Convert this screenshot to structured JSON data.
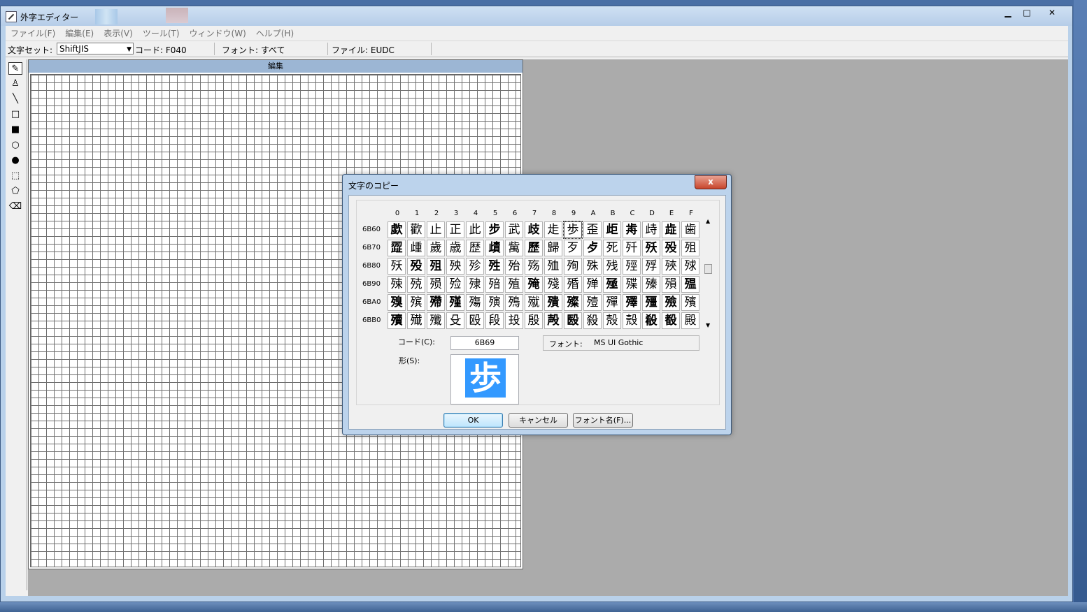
{
  "window": {
    "title": "外字エディター",
    "buttons": {
      "minimize": "▁",
      "maximize": "□",
      "close": "✕"
    }
  },
  "menu": [
    "ファイル(F)",
    "編集(E)",
    "表示(V)",
    "ツール(T)",
    "ウィンドウ(W)",
    "ヘルプ(H)"
  ],
  "infobar": {
    "charset_label": "文字セット:",
    "charset_value": "ShiftJIS",
    "code": "コード: F040",
    "font": "フォント: すべて",
    "file": "ファイル: EUDC"
  },
  "tools": [
    "pencil-icon",
    "brush-icon",
    "line-icon",
    "hollow-rect-icon",
    "filled-rect-icon",
    "hollow-ellipse-icon",
    "filled-ellipse-icon",
    "rect-select-icon",
    "freeform-select-icon",
    "eraser-icon"
  ],
  "editor": {
    "title": "編集"
  },
  "dialog": {
    "title": "文字のコピー",
    "close": "x",
    "columns": [
      "0",
      "1",
      "2",
      "3",
      "4",
      "5",
      "6",
      "7",
      "8",
      "9",
      "A",
      "B",
      "C",
      "D",
      "E",
      "F"
    ],
    "rows": [
      {
        "code": "6B60",
        "chars": [
          "歔",
          "歡",
          "止",
          "正",
          "此",
          "步",
          "武",
          "歧",
          "歨",
          "歩",
          "歪",
          "歫",
          "歬",
          "歭",
          "歮",
          "歯"
        ]
      },
      {
        "code": "6B70",
        "chars": [
          "歰",
          "歱",
          "歲",
          "歳",
          "歴",
          "歵",
          "歶",
          "歷",
          "歸",
          "歹",
          "歺",
          "死",
          "歼",
          "殀",
          "殁",
          "殂"
        ]
      },
      {
        "code": "6B80",
        "chars": [
          "殀",
          "殁",
          "殂",
          "殃",
          "殄",
          "殅",
          "殆",
          "殇",
          "殈",
          "殉",
          "殊",
          "残",
          "殌",
          "殍",
          "殎",
          "殏"
        ]
      },
      {
        "code": "6B90",
        "chars": [
          "殐",
          "殑",
          "殒",
          "殓",
          "殔",
          "殕",
          "殖",
          "殗",
          "殘",
          "殙",
          "殚",
          "殛",
          "殜",
          "殝",
          "殞",
          "殟"
        ]
      },
      {
        "code": "6BA0",
        "chars": [
          "殠",
          "殡",
          "殢",
          "殣",
          "殤",
          "殥",
          "殦",
          "殧",
          "殨",
          "殩",
          "殪",
          "殫",
          "殬",
          "殭",
          "殮",
          "殯"
        ]
      },
      {
        "code": "6BB0",
        "chars": [
          "殰",
          "殱",
          "殲",
          "殳",
          "殴",
          "段",
          "殶",
          "殷",
          "殸",
          "殹",
          "殺",
          "殻",
          "殼",
          "殽",
          "殾",
          "殿"
        ]
      }
    ],
    "code_label": "コード(C):",
    "code_value": "6B69",
    "font_label": "フォント:",
    "font_value": "MS UI Gothic",
    "shape_label": "形(S):",
    "shape_char": "歩",
    "ok": "OK",
    "cancel": "キャンセル",
    "fontname": "フォント名(F)..."
  }
}
